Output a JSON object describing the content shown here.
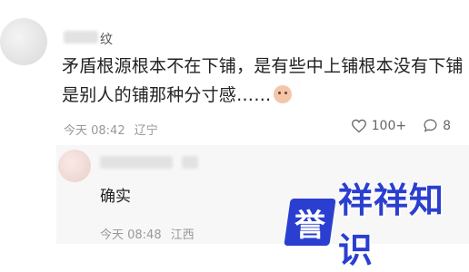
{
  "comment": {
    "username_suffix": "纹",
    "text": "矛盾根源根本不在下铺，是有些中上铺根本没有下铺是别人的铺那种分寸感……",
    "time": "今天 08:42",
    "location": "辽宁",
    "likes": "100+",
    "replies": "8"
  },
  "reply": {
    "text": "确实",
    "time": "今天 08:48",
    "location": "江西"
  },
  "watermark": {
    "logo_char": "誉",
    "text": "祥祥知识"
  },
  "icons": {
    "like": "heart-icon",
    "comment": "comment-icon",
    "emoji": "blush-emoji-icon"
  }
}
